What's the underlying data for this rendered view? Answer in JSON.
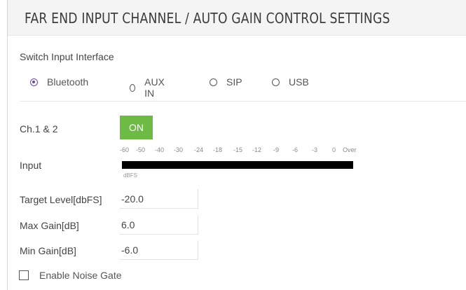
{
  "header": {
    "title": "FAR END INPUT CHANNEL / AUTO GAIN CONTROL SETTINGS"
  },
  "input_interface": {
    "label": "Switch Input Interface",
    "selected": "Bluetooth",
    "options": [
      "Bluetooth",
      "AUX IN",
      "SIP",
      "USB"
    ]
  },
  "channel": {
    "label": "Ch.1 & 2",
    "toggle_label": "ON",
    "toggle_color": "#6dbb45"
  },
  "input_meter": {
    "label": "Input",
    "scale": [
      "-60",
      "-50",
      "-40",
      "-30",
      "-24",
      "-18",
      "-15",
      "-12",
      "-9",
      "-6",
      "-3",
      "0",
      "Over"
    ],
    "unit": "dBFS"
  },
  "target_level": {
    "label": "Target Level[dbFS]",
    "value": "-20.0"
  },
  "max_gain": {
    "label": "Max Gain[dB]",
    "value": "6.0"
  },
  "min_gain": {
    "label": "Min Gain[dB]",
    "value": "-6.0"
  },
  "noise_gate": {
    "label": "Enable Noise Gate",
    "checked": false
  },
  "colors": {
    "accent": "#6b4aa3",
    "on_button": "#6dbb45",
    "header_bg": "#f4f4f4"
  }
}
